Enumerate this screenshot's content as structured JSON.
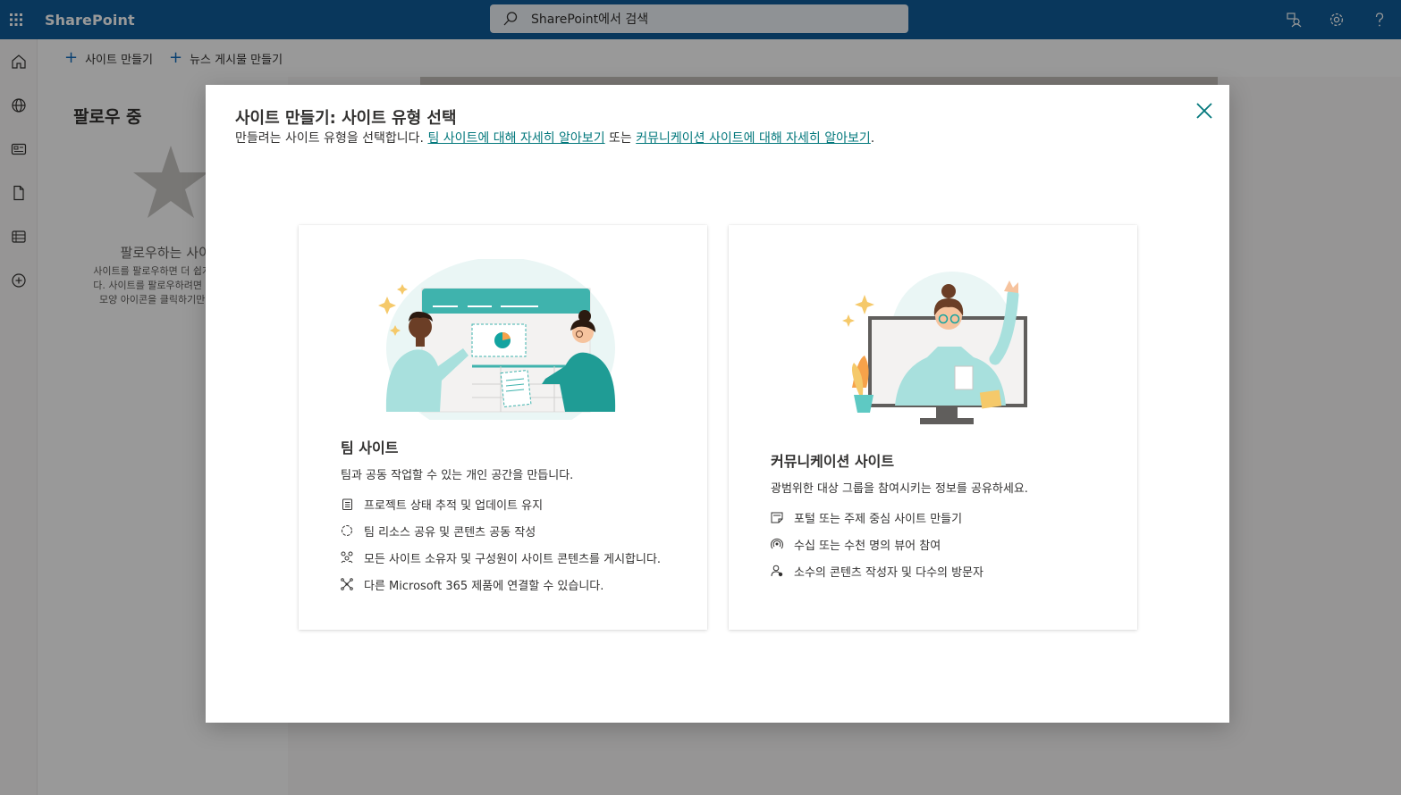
{
  "suitebar": {
    "brand": "SharePoint",
    "search_placeholder": "SharePoint에서 검색"
  },
  "commands": {
    "create_site": "사이트 만들기",
    "create_news": "뉴스 게시물 만들기"
  },
  "following": {
    "title": "팔로우 중",
    "empty_heading": "팔로우하는 사이트가 없",
    "empty_line1": "사이트를 팔로우하면 더 쉽게 찾",
    "empty_line2": "다. 사이트를 팔로우하려면 사이",
    "empty_line3": "모양 아이콘을 클릭하기만 하"
  },
  "dialog": {
    "title": "사이트 만들기: 사이트 유형 선택",
    "subtitle_prefix": "만들려는 사이트 유형을 선택합니다. ",
    "team_link": "팀 사이트에 대해 자세히 알아보기",
    "subtitle_or": " 또는 ",
    "comm_link": "커뮤니케이션 사이트에 대해 자세히 알아보기",
    "subtitle_suffix": "."
  },
  "team_card": {
    "title": "팀 사이트",
    "description": "팀과 공동 작업할 수 있는 개인 공간을 만듭니다.",
    "features": [
      {
        "icon": "checklist-icon",
        "text": "프로젝트 상태 추적 및 업데이트 유지"
      },
      {
        "icon": "sync-icon",
        "text": "팀 리소스 공유 및 콘텐츠 공동 작성"
      },
      {
        "icon": "people-network-icon",
        "text": "모든 사이트 소유자 및 구성원이 사이트 콘텐츠를 게시합니다."
      },
      {
        "icon": "connect-icon",
        "text": "다른 Microsoft 365 제품에 연결할 수 있습니다."
      }
    ]
  },
  "comm_card": {
    "title": "커뮤니케이션 사이트",
    "description": "광범위한 대상 그룹을 참여시키는 정보를 공유하세요.",
    "features": [
      {
        "icon": "edit-page-icon",
        "text": "포털 또는 주제 중심 사이트 만들기"
      },
      {
        "icon": "broadcast-icon",
        "text": "수십 또는 수천 명의 뷰어 참여"
      },
      {
        "icon": "person-audience-icon",
        "text": "소수의 콘텐츠 작성자 및 다수의 방문자"
      }
    ]
  },
  "colors": {
    "suitebar": "#0f5c9a",
    "accent_teal": "#03787c",
    "illustration_teal": "#3fb3ad"
  }
}
